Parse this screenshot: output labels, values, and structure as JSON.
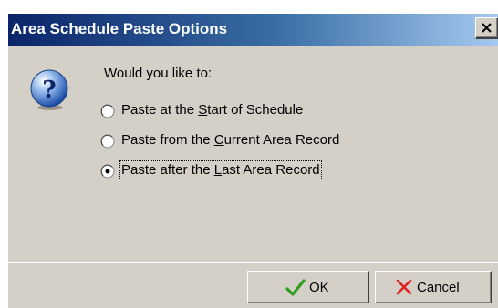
{
  "dialog": {
    "title": "Area Schedule Paste Options",
    "prompt": "Would you like to:",
    "options": [
      {
        "pre": "Paste at the ",
        "accel": "S",
        "post": "tart of Schedule",
        "selected": false
      },
      {
        "pre": "Paste from the ",
        "accel": "C",
        "post": "urrent Area Record",
        "selected": false
      },
      {
        "pre": "Paste after the ",
        "accel": "L",
        "post": "ast Area Record",
        "selected": true
      }
    ],
    "ok_label": "OK",
    "cancel_label": "Cancel"
  },
  "icons": {
    "dialog_icon": "question-icon",
    "ok_icon": "checkmark-icon",
    "cancel_icon": "x-icon",
    "close_icon": "close-icon"
  },
  "colors": {
    "titlebar_start": "#0a246a",
    "titlebar_end": "#a6caf0",
    "dialog_face": "#d4d0c8",
    "checkmark": "#2e9e1e",
    "cancel_x": "#e02020"
  }
}
